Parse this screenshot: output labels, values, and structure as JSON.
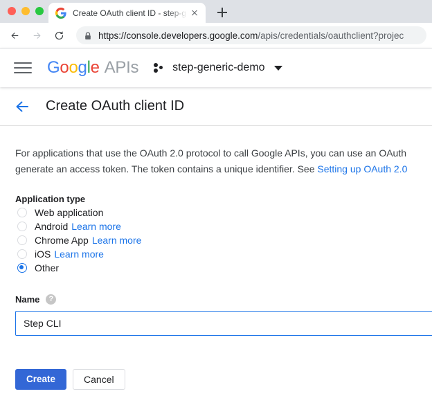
{
  "browser": {
    "tab": {
      "title": "Create OAuth client ID - step-g",
      "favicon_name": "google-favicon",
      "close_label": "Close tab"
    },
    "new_tab_label": "New tab",
    "nav": {
      "back_label": "Back",
      "forward_label": "Forward",
      "reload_label": "Reload"
    },
    "omnibox": {
      "lock_label": "Secure connection",
      "url_host": "https://console.developers.google.com",
      "url_path": "/apis/credentials/oauthclient?projec"
    }
  },
  "appbar": {
    "menu_label": "Main menu",
    "brand": {
      "g1": "G",
      "o1": "o",
      "o2": "o",
      "g2": "g",
      "l": "l",
      "e": "e",
      "apis": "APIs"
    },
    "project": {
      "name": "step-generic-demo",
      "icon_name": "project-dots-icon",
      "caret_name": "chevron-down-icon"
    }
  },
  "page": {
    "back_label": "Back",
    "title": "Create OAuth client ID",
    "description_line1": "For applications that use the OAuth 2.0 protocol to call Google APIs, you can use an OAuth",
    "description_line2_pre": "generate an access token. The token contains a unique identifier. See ",
    "description_link": "Setting up OAuth 2.0",
    "application_type": {
      "label": "Application type",
      "options": [
        {
          "label": "Web application",
          "link": "",
          "selected": false
        },
        {
          "label": "Android",
          "link": "Learn more",
          "selected": false
        },
        {
          "label": "Chrome App",
          "link": "Learn more",
          "selected": false
        },
        {
          "label": "iOS",
          "link": "Learn more",
          "selected": false
        },
        {
          "label": "Other",
          "link": "",
          "selected": true
        }
      ]
    },
    "name_field": {
      "label": "Name",
      "help_glyph": "?",
      "value": "Step CLI",
      "placeholder": ""
    },
    "actions": {
      "create": "Create",
      "cancel": "Cancel"
    }
  },
  "colors": {
    "accent_blue": "#1a73e8",
    "button_blue": "#3367d6",
    "chrome_gray": "#dee1e6",
    "text_primary": "#202124"
  }
}
